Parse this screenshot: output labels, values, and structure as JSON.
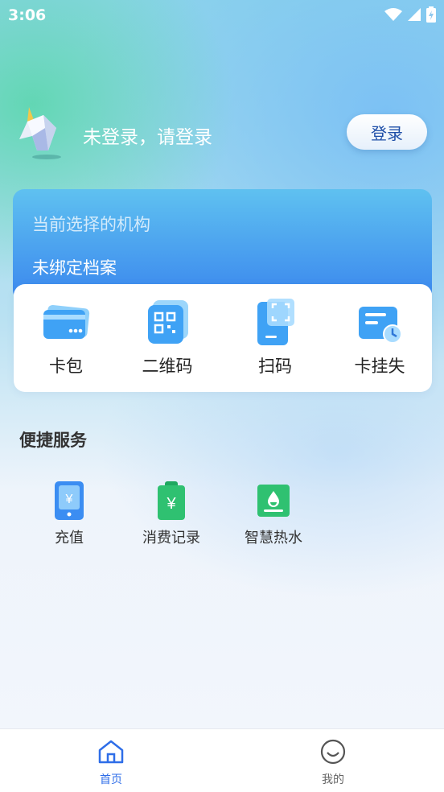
{
  "status_bar": {
    "time": "3:06"
  },
  "header": {
    "greeting": "未登录，请登录",
    "login_button": "登录"
  },
  "institution": {
    "title": "当前选择的机构",
    "value": "未绑定档案"
  },
  "quick_actions": [
    {
      "label": "卡包",
      "icon": "card-wallet-icon"
    },
    {
      "label": "二维码",
      "icon": "qrcode-icon"
    },
    {
      "label": "扫码",
      "icon": "scan-icon"
    },
    {
      "label": "卡挂失",
      "icon": "card-loss-icon"
    }
  ],
  "services": {
    "title": "便捷服务",
    "items": [
      {
        "label": "充值",
        "icon": "recharge-icon"
      },
      {
        "label": "消费记录",
        "icon": "consumption-record-icon"
      },
      {
        "label": "智慧热水",
        "icon": "smart-hot-water-icon"
      }
    ]
  },
  "bottom_nav": [
    {
      "label": "首页",
      "icon": "home-icon",
      "active": true
    },
    {
      "label": "我的",
      "icon": "profile-icon",
      "active": false
    }
  ],
  "colors": {
    "accent": "#2f6ee8",
    "card_gradient_top": "#5fc1f0",
    "card_gradient_bottom": "#3a86ee",
    "nav_inactive": "#666666"
  }
}
